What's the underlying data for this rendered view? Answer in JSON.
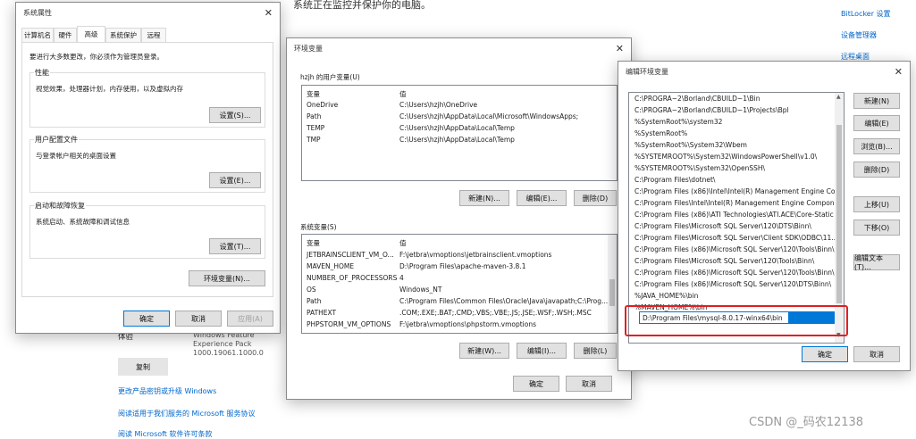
{
  "background": {
    "heading": "系统正在监控并保护你的电脑。",
    "links_right": [
      "BitLocker 设置",
      "设备管理器",
      "远程桌面"
    ],
    "experience_label": "体验",
    "experience_value": "Windows Feature Experience Pack 1000.19061.1000.0",
    "copy_button": "复制",
    "links_bottom": [
      "更改产品密钥或升级 Windows",
      "阅读适用于我们服务的 Microsoft 服务协议",
      "阅读 Microsoft 软件许可条款"
    ],
    "watermark": "CSDN @_码农12138"
  },
  "sysprops": {
    "title": "系统属性",
    "tabs": [
      "计算机名",
      "硬件",
      "高级",
      "系统保护",
      "远程"
    ],
    "admin_note": "要进行大多数更改，你必须作为管理员登录。",
    "perf_title": "性能",
    "perf_desc": "视觉效果，处理器计划，内存使用，以及虚拟内存",
    "profile_title": "用户配置文件",
    "profile_desc": "与登录帐户相关的桌面设置",
    "startup_title": "启动和故障恢复",
    "startup_desc": "系统启动、系统故障和调试信息",
    "settings_s": "设置(S)...",
    "settings_e": "设置(E)...",
    "settings_t": "设置(T)...",
    "env_button": "环境变量(N)...",
    "ok": "确定",
    "cancel": "取消",
    "apply": "应用(A)"
  },
  "envvars": {
    "title": "环境变量",
    "user_section": "hzjh 的用户变量(U)",
    "col_var": "变量",
    "col_val": "值",
    "user_rows": [
      {
        "name": "OneDrive",
        "value": "C:\\Users\\hzjh\\OneDrive"
      },
      {
        "name": "Path",
        "value": "C:\\Users\\hzjh\\AppData\\Local\\Microsoft\\WindowsApps;"
      },
      {
        "name": "TEMP",
        "value": "C:\\Users\\hzjh\\AppData\\Local\\Temp"
      },
      {
        "name": "TMP",
        "value": "C:\\Users\\hzjh\\AppData\\Local\\Temp"
      }
    ],
    "user_new": "新建(N)...",
    "user_edit": "编辑(E)...",
    "user_delete": "删除(D)",
    "sys_section": "系统变量(S)",
    "sys_rows": [
      {
        "name": "JETBRAINSCLIENT_VM_O...",
        "value": "F:\\jetbra\\vmoptions\\jetbrainsclient.vmoptions"
      },
      {
        "name": "MAVEN_HOME",
        "value": "D:\\Program Files\\apache-maven-3.8.1"
      },
      {
        "name": "NUMBER_OF_PROCESSORS",
        "value": "4"
      },
      {
        "name": "OS",
        "value": "Windows_NT"
      },
      {
        "name": "Path",
        "value": "C:\\Program Files\\Common Files\\Oracle\\Java\\javapath;C:\\Prog..."
      },
      {
        "name": "PATHEXT",
        "value": ".COM;.EXE;.BAT;.CMD;.VBS;.VBE;.JS;.JSE;.WSF;.WSH;.MSC"
      },
      {
        "name": "PHPSTORM_VM_OPTIONS",
        "value": "F:\\jetbra\\vmoptions\\phpstorm.vmoptions"
      }
    ],
    "sys_new": "新建(W)...",
    "sys_edit": "编辑(I)...",
    "sys_delete": "删除(L)",
    "ok": "确定",
    "cancel": "取消"
  },
  "editenv": {
    "title": "编辑环境变量",
    "entries": [
      "C:\\PROGRA~2\\Borland\\CBUILD~1\\Bin",
      "C:\\PROGRA~2\\Borland\\CBUILD~1\\Projects\\Bpl",
      "%SystemRoot%\\system32",
      "%SystemRoot%",
      "%SystemRoot%\\System32\\Wbem",
      "%SYSTEMROOT%\\System32\\WindowsPowerShell\\v1.0\\",
      "%SYSTEMROOT%\\System32\\OpenSSH\\",
      "C:\\Program Files\\dotnet\\",
      "C:\\Program Files (x86)\\Intel\\Intel(R) Management Engine Co...",
      "C:\\Program Files\\Intel\\Intel(R) Management Engine Compon...",
      "C:\\Program Files (x86)\\ATI Technologies\\ATI.ACE\\Core-Static",
      "C:\\Program Files\\Microsoft SQL Server\\120\\DTS\\Binn\\",
      "C:\\Program Files\\Microsoft SQL Server\\Client SDK\\ODBC\\11...",
      "C:\\Program Files (x86)\\Microsoft SQL Server\\120\\Tools\\Binn\\",
      "C:\\Program Files\\Microsoft SQL Server\\120\\Tools\\Binn\\",
      "C:\\Program Files (x86)\\Microsoft SQL Server\\120\\Tools\\Binn\\",
      "C:\\Program Files (x86)\\Microsoft SQL Server\\120\\DTS\\Binn\\",
      "%JAVA_HOME%\\bin",
      "%MAVEN_HOME%\\bin"
    ],
    "editing_value": "D:\\Program Files\\mysql-8.0.17-winx64\\bin",
    "btn_new": "新建(N)",
    "btn_edit": "编辑(E)",
    "btn_browse": "浏览(B)...",
    "btn_delete": "删除(D)",
    "btn_up": "上移(U)",
    "btn_down": "下移(O)",
    "btn_edit_text": "编辑文本(T)...",
    "ok": "确定",
    "cancel": "取消",
    "highlight_color": "#e02020",
    "selection_color": "#0078d7"
  }
}
